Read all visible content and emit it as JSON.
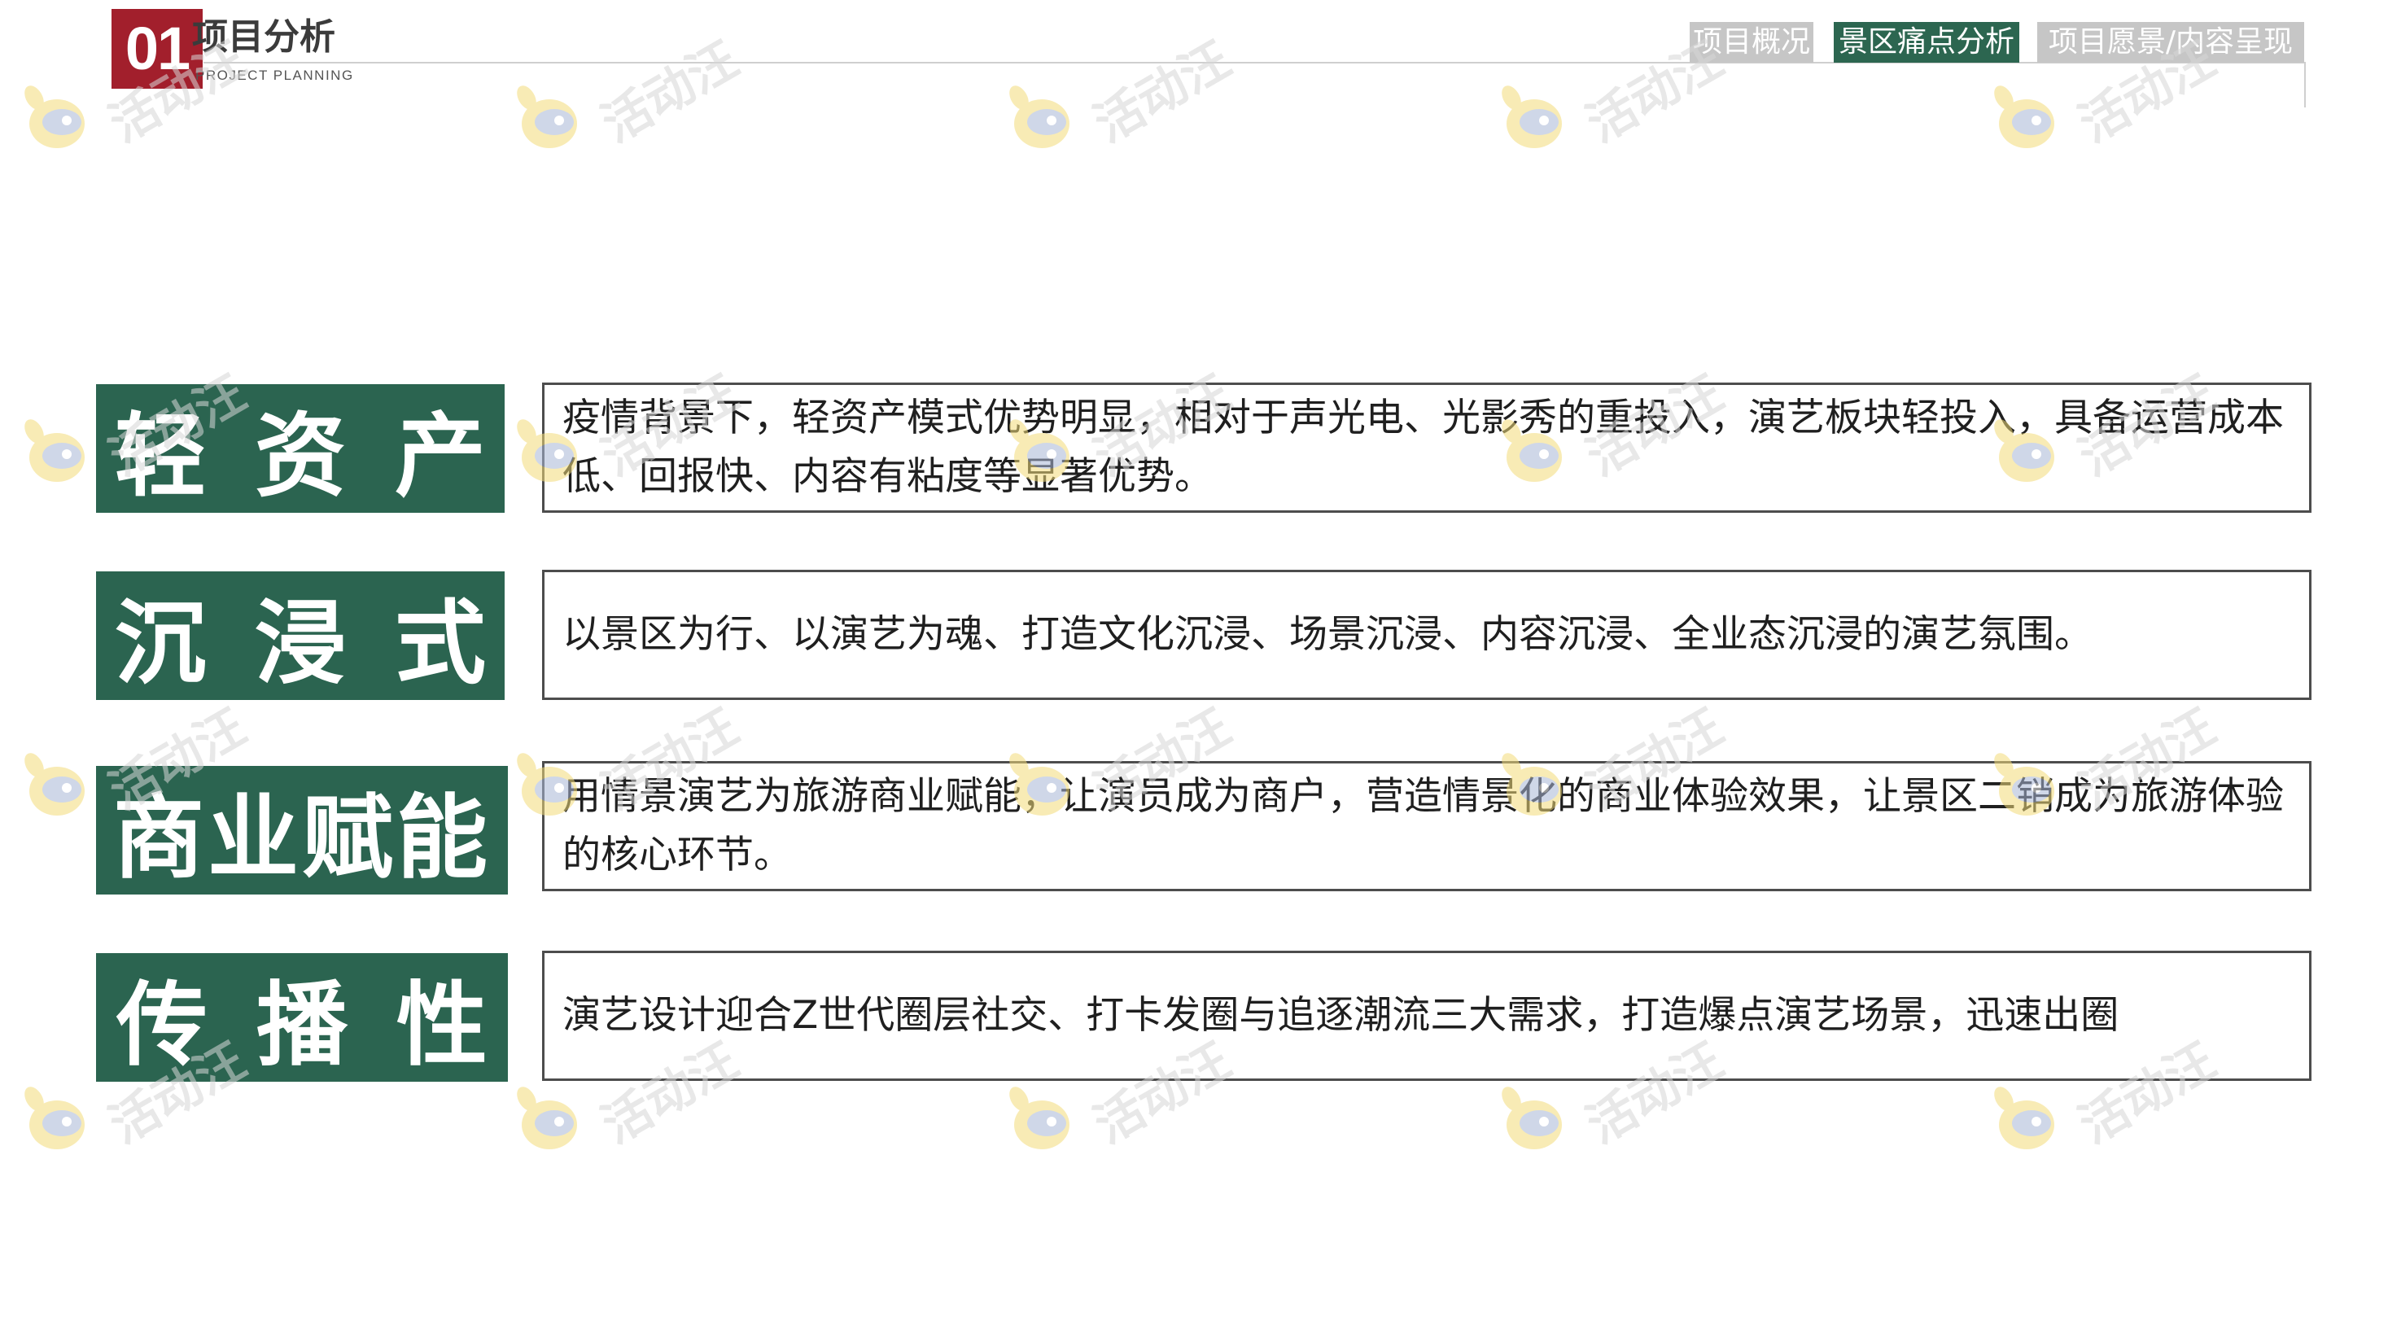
{
  "header": {
    "section_number": "01",
    "section_title": "项目分析",
    "section_subtitle": "PROJECT PLANNING",
    "tabs": [
      {
        "label": "项目概况",
        "active": false
      },
      {
        "label": "景区痛点分析",
        "active": true
      },
      {
        "label": "项目愿景/内容呈现",
        "active": false
      }
    ]
  },
  "rows": [
    {
      "label": "轻资产",
      "text": "疫情背景下，轻资产模式优势明显，相对于声光电、光影秀的重投入，演艺板块轻投入，具备运营成本低、回报快、内容有粘度等显著优势。"
    },
    {
      "label": "沉浸式",
      "text": "以景区为行、以演艺为魂、打造文化沉浸、场景沉浸、内容沉浸、全业态沉浸的演艺氛围。"
    },
    {
      "label": "商业赋能",
      "text": "用情景演艺为旅游商业赋能，让演员成为商户，营造情景化的商业体验效果，让景区二销成为旅游体验的核心环节。"
    },
    {
      "label": "传播性",
      "text": "演艺设计迎合Z世代圈层社交、打卡发圈与追逐潮流三大需求，打造爆点演艺场景，迅速出圈"
    }
  ],
  "watermark": {
    "text": "活动汪",
    "icon": "mascot-icon"
  },
  "colors": {
    "brand_green": "#2b6450",
    "badge_red": "#a21f2c",
    "tab_inactive": "#c6c6c6"
  }
}
